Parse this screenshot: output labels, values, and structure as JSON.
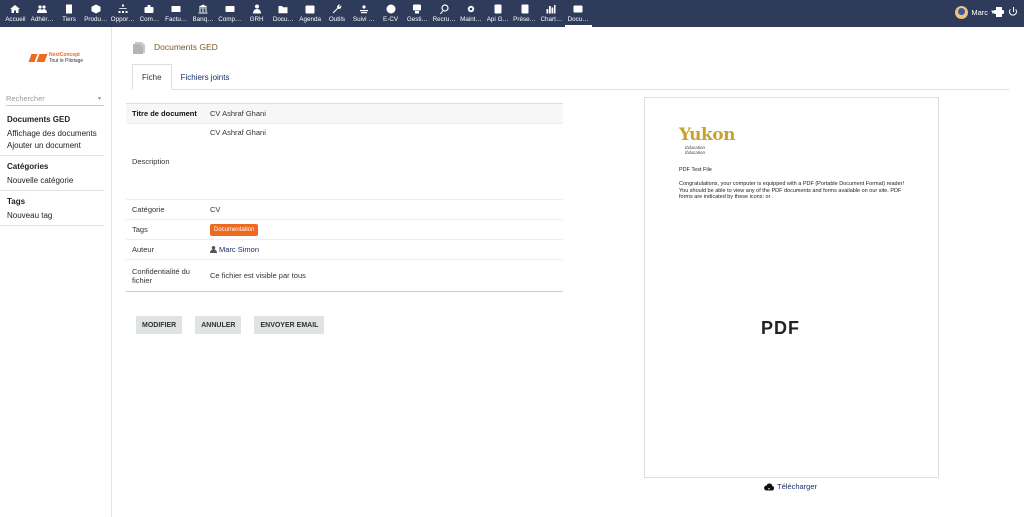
{
  "nav": [
    {
      "label": "Accueil",
      "icon": "home-icon"
    },
    {
      "label": "Adhér…",
      "icon": "users-icon"
    },
    {
      "label": "Tiers",
      "icon": "building-icon"
    },
    {
      "label": "Produ…",
      "icon": "cube-icon"
    },
    {
      "label": "Oppor…",
      "icon": "sitemap-icon"
    },
    {
      "label": "Com…",
      "icon": "briefcase-icon"
    },
    {
      "label": "Factu…",
      "icon": "money-icon"
    },
    {
      "label": "Banq…",
      "icon": "bank-icon"
    },
    {
      "label": "Comp…",
      "icon": "calculator-icon"
    },
    {
      "label": "GRH",
      "icon": "person-icon"
    },
    {
      "label": "Docu…",
      "icon": "folder-icon"
    },
    {
      "label": "Agenda",
      "icon": "calendar-icon"
    },
    {
      "label": "Outils",
      "icon": "wrench-icon"
    },
    {
      "label": "Suivi …",
      "icon": "tracking-icon"
    },
    {
      "label": "E-CV",
      "icon": "cv-icon"
    },
    {
      "label": "Gesti…",
      "icon": "manage-icon"
    },
    {
      "label": "Recru…",
      "icon": "search-person-icon"
    },
    {
      "label": "Maint…",
      "icon": "gear-icon"
    },
    {
      "label": "Api G…",
      "icon": "api-icon"
    },
    {
      "label": "Prése…",
      "icon": "presence-icon"
    },
    {
      "label": "Chart…",
      "icon": "chart-icon"
    },
    {
      "label": "Docu…",
      "icon": "ged-icon"
    }
  ],
  "user": {
    "name": "Marc"
  },
  "sidebar": {
    "logo": {
      "brand": "NextConcept",
      "tagline": "Tout le Pilotage"
    },
    "search_placeholder": "Rechercher",
    "sections": [
      {
        "title": "Documents GED",
        "items": [
          "Affichage des documents",
          "Ajouter un document"
        ]
      },
      {
        "title": "Catégories",
        "items": [
          "Nouvelle catégorie"
        ]
      },
      {
        "title": "Tags",
        "items": [
          "Nouveau tag"
        ]
      }
    ]
  },
  "page": {
    "title": "Documents GED"
  },
  "tabs": [
    {
      "label": "Fiche"
    },
    {
      "label": "Fichiers joints"
    }
  ],
  "fields": {
    "titre": {
      "label": "Titre de document",
      "value": "CV Ashraf Ghani"
    },
    "description": {
      "label": "Description",
      "value": "CV Ashraf Ghani"
    },
    "categorie": {
      "label": "Catégorie",
      "value": "CV"
    },
    "tags": {
      "label": "Tags",
      "value": "Documentation"
    },
    "auteur": {
      "label": "Auteur",
      "value": "Marc Simon"
    },
    "confidentialite": {
      "label": "Confidentialité du fichier",
      "value": "Ce fichier est visible par tous"
    }
  },
  "buttons": {
    "modifier": "MODIFIER",
    "annuler": "ANNULER",
    "email": "ENVOYER EMAIL"
  },
  "preview": {
    "brand_word": "Yukon",
    "brand_sub1": "Education",
    "brand_sub2": "Éducation",
    "file_title": "PDF Test File",
    "body": "Congratulations, your computer is equipped with a PDF (Portable Document Format) reader!  You should be able to view any of the PDF documents and forms available on our site.  PDF forms are indicated by these icons:  or .",
    "big_label": "PDF"
  },
  "download_label": "Télécharger",
  "colors": {
    "topbar": "#2e3b5b",
    "accent": "#ee6a1e",
    "link": "#1a2f6b"
  }
}
